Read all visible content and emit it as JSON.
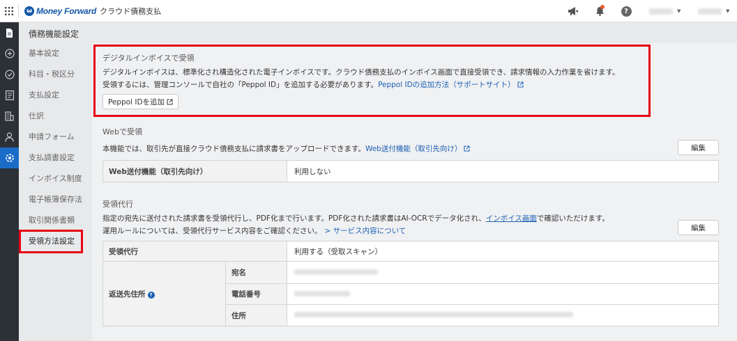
{
  "header": {
    "logo_mark": "ω",
    "brand": "Money Forward",
    "product": "クラウド債務支払"
  },
  "icons": {
    "apps": "grid-icon",
    "announce": "megaphone-icon",
    "notify": "bell-icon",
    "help_glyph": "?"
  },
  "colors": {
    "brand": "#1558a8",
    "highlight": "#e50012",
    "link": "#1a5fb4",
    "rail_active": "#1b6cc7"
  },
  "nav": {
    "title": "債務機能設定",
    "items": [
      {
        "label": "基本設定"
      },
      {
        "label": "科目・税区分"
      },
      {
        "label": "支払設定"
      },
      {
        "label": "仕訳"
      },
      {
        "label": "申請フォーム"
      },
      {
        "label": "支払調書設定"
      },
      {
        "label": "インボイス制度"
      },
      {
        "label": "電子帳簿保存法"
      },
      {
        "label": "取引関係書類"
      },
      {
        "label": "受領方法設定"
      }
    ],
    "selected_index": 9
  },
  "digital": {
    "title": "デジタルインボイスで受領",
    "line1": "デジタルインボイスは、標準化され構造化された電子インボイスです。クラウド債務支払のインボイス画面で直接受領でき、請求情報の入力作業を省けます。",
    "line2": "受領するには、管理コンソールで自社の「Peppol ID」を追加する必要があります。",
    "link": "Peppol IDの追加方法（サポートサイト）",
    "button": "Peppol IDを追加"
  },
  "web": {
    "title": "Webで受領",
    "desc": "本機能では、取引先が直接クラウド債務支払に請求書をアップロードできます。",
    "link": "Web送付機能（取引先向け）",
    "edit": "編集",
    "row_label": "Web送付機能（取引先向け）",
    "row_value": "利用しない"
  },
  "proxy": {
    "title": "受領代行",
    "line1a": "指定の宛先に送付された請求書を受領代行し、PDF化まで行います。PDF化された請求書はAI-OCRでデータ化され、",
    "line1_link": "インボイス画面",
    "line1b": "で確認いただけます。",
    "line2": "運用ルールについては、受領代行サービス内容をご確認ください。",
    "line2_link": "> サービス内容について",
    "edit": "編集",
    "row_label": "受領代行",
    "row_value": "利用する（受取スキャン）",
    "address_label": "返送先住所",
    "fields": [
      {
        "label": "宛名"
      },
      {
        "label": "電話番号"
      },
      {
        "label": "住所"
      }
    ]
  }
}
